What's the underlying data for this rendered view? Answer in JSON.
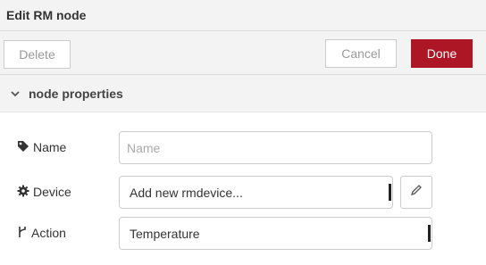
{
  "header": {
    "title": "Edit RM node"
  },
  "toolbar": {
    "delete_label": "Delete",
    "cancel_label": "Cancel",
    "done_label": "Done"
  },
  "section": {
    "title": "node properties",
    "icon": "chevron-down-icon"
  },
  "form": {
    "name": {
      "label": "Name",
      "icon": "tag-icon",
      "value": "",
      "placeholder": "Name"
    },
    "device": {
      "label": "Device",
      "icon": "gear-icon",
      "value": "Add new rmdevice...",
      "edit_icon": "pencil-icon"
    },
    "action": {
      "label": "Action",
      "icon": "branch-icon",
      "value": "Temperature"
    }
  },
  "colors": {
    "done_button": "#ad1625",
    "header_background": "#f3f3f3",
    "border": "#cccccc"
  }
}
